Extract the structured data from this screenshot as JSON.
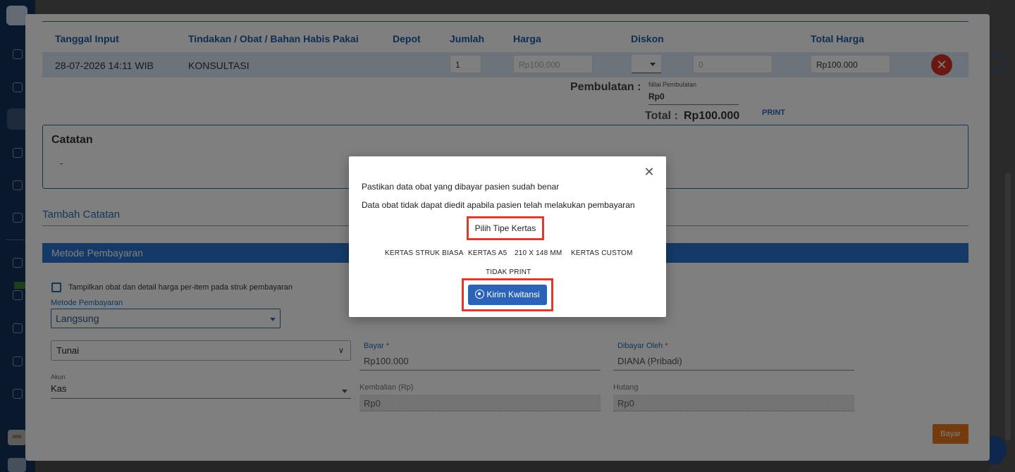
{
  "table": {
    "headers": [
      "Tanggal Input",
      "Tindakan / Obat / Bahan Habis Pakai",
      "Depot",
      "Jumlah",
      "Harga",
      "Diskon",
      "Total Harga"
    ],
    "row": {
      "tanggal": "28-07-2026 14:11 WIB",
      "tindakan": "KONSULTASI",
      "jumlah": "1",
      "harga": "Rp100.000",
      "diskon": "0",
      "total_harga": "Rp100.000",
      "delete_icon": "close-icon"
    }
  },
  "summary": {
    "pembulatan_label": "Pembulatan :",
    "nilai_pembulatan_label": "Nilai Pembulatan",
    "nilai_pembulatan_value": "Rp0",
    "total_label": "Total :",
    "total_value": "Rp100.000",
    "print_label": "PRINT"
  },
  "catatan": {
    "title": "Catatan",
    "value": "-",
    "tambah_label": "Tambah Catatan"
  },
  "payment": {
    "section_title": "Metode Pembayaran",
    "show_detail_label": "Tampilkan obat dan detail harga per-item pada struk pembayaran",
    "metode_label": "Metode Pembayaran",
    "metode_value": "Langsung",
    "tipe_value": "Tunai",
    "bayar_label": "Bayar",
    "bayar_value": "Rp100.000",
    "dibayar_oleh_label": "Dibayar Oleh",
    "dibayar_oleh_value": "DIANA (Pribadi)",
    "akun_label": "Akun",
    "akun_value": "Kas",
    "kembalian_label": "Kembalian (Rp)",
    "kembalian_value": "Rp0",
    "hutang_label": "Hutang",
    "hutang_value": "Rp0",
    "submit_label": "Bayar",
    "required_mark": "*"
  },
  "sidebar": {
    "opd_label": "OPD"
  },
  "modal": {
    "line1": "Pastikan data obat yang dibayar pasien sudah benar",
    "line2": "Data obat tidak dapat diedit apabila pasien telah melakukan pembayaran",
    "pilih_label": "Pilih Tipe Kertas",
    "options": [
      "KERTAS STRUK BIASA",
      "KERTAS A5",
      "210 X 148 MM",
      "KERTAS CUSTOM"
    ],
    "tidak_print": "TIDAK PRINT",
    "kirim_label": "Kirim Kwitansi",
    "close_icon": "close-icon",
    "whatsapp_icon": "whatsapp-icon"
  },
  "colors": {
    "accent": "#2b6cb0",
    "highlight_box": "#e03a2f",
    "delete": "#d93025",
    "bayar_button": "#e8771e"
  }
}
